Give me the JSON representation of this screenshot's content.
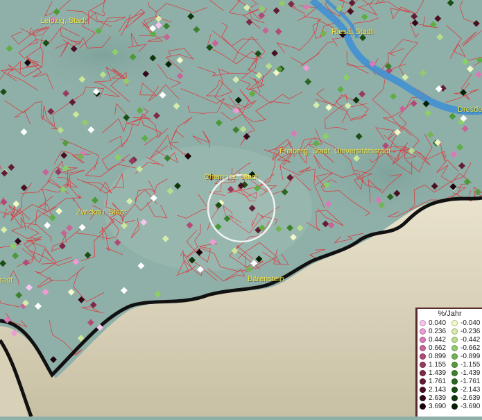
{
  "map": {
    "cities": [
      {
        "id": "leipzig",
        "label": "Leipzig, Stadt"
      },
      {
        "id": "riesa",
        "label": "Riesa, Stadt"
      },
      {
        "id": "dresden",
        "label": "Dresde"
      },
      {
        "id": "freiberg",
        "label": "Freiberg, Stadt, Universitätsstadt"
      },
      {
        "id": "chemnitz",
        "label": "Chemnitz, Stadt"
      },
      {
        "id": "zwickau",
        "label": "Zwickau, Stadt"
      },
      {
        "id": "baerenstein",
        "label": "Bärenstein"
      },
      {
        "id": "stadt-west",
        "label": "tadt"
      }
    ],
    "colors": {
      "terrain": "#8fb0a8",
      "boundary": "#e0333a",
      "river": "#3d8fd6",
      "border": "#111111",
      "label": "#f4e23a"
    }
  },
  "legend": {
    "title": "%/Jahr",
    "positive": [
      {
        "value": "0.040",
        "color": "#f6c6ef"
      },
      {
        "value": "0.236",
        "color": "#ee9ad4"
      },
      {
        "value": "0.442",
        "color": "#d97ab7"
      },
      {
        "value": "0.662",
        "color": "#c86596"
      },
      {
        "value": "0.899",
        "color": "#b24a78"
      },
      {
        "value": "1.155",
        "color": "#983a5f"
      },
      {
        "value": "1.439",
        "color": "#7c2a47"
      },
      {
        "value": "1.761",
        "color": "#621c33"
      },
      {
        "value": "2.143",
        "color": "#491022"
      },
      {
        "value": "2.639",
        "color": "#320816"
      },
      {
        "value": "3.690",
        "color": "#1c020a"
      }
    ],
    "negative": [
      {
        "value": "-0.040",
        "color": "#f3f8c6"
      },
      {
        "value": "-0.236",
        "color": "#d6ecaa"
      },
      {
        "value": "-0.442",
        "color": "#b8dd8b"
      },
      {
        "value": "-0.662",
        "color": "#95c96d"
      },
      {
        "value": "-0.899",
        "color": "#74b354"
      },
      {
        "value": "-1.155",
        "color": "#569a3f"
      },
      {
        "value": "-1.439",
        "color": "#3d802e"
      },
      {
        "value": "-1.761",
        "color": "#2a6720"
      },
      {
        "value": "-2.143",
        "color": "#1a4e14"
      },
      {
        "value": "-2.639",
        "color": "#0e370b"
      },
      {
        "value": "-3.690",
        "color": "#052005"
      }
    ]
  }
}
